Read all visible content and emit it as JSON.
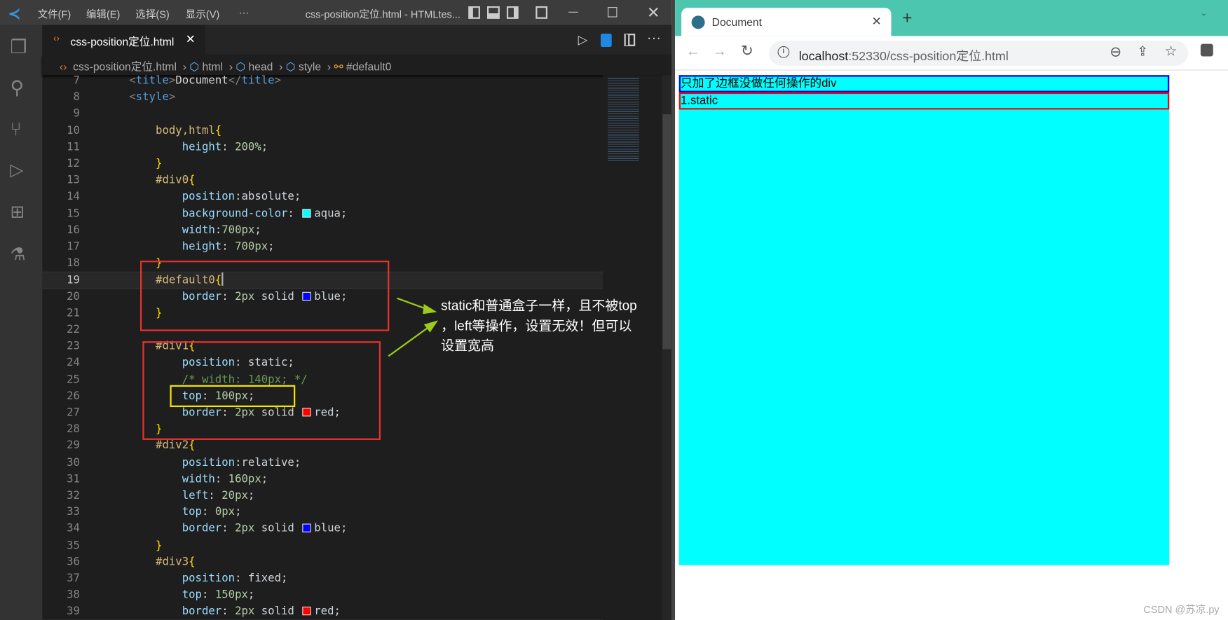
{
  "vscode": {
    "menu": [
      "文件(F)",
      "编辑(E)",
      "选择(S)",
      "显示(V)",
      "···"
    ],
    "window_title": "css-position定位.html - HTMLtes...",
    "tab_label": "css-position定位.html",
    "breadcrumb": [
      "css-position定位.html",
      "html",
      "head",
      "style",
      "#default0"
    ],
    "cursor_line": 19,
    "lines": [
      {
        "n": 7,
        "i": 2,
        "t": [
          [
            "br",
            "<"
          ],
          [
            "tag",
            "title"
          ],
          [
            "br",
            ">"
          ],
          [
            "txt",
            "Document"
          ],
          [
            "br",
            "</"
          ],
          [
            "tag",
            "title"
          ],
          [
            "br",
            ">"
          ]
        ]
      },
      {
        "n": 8,
        "i": 2,
        "t": [
          [
            "br",
            "<"
          ],
          [
            "tag",
            "style"
          ],
          [
            "br",
            ">"
          ]
        ]
      },
      {
        "n": 9,
        "i": 0,
        "t": []
      },
      {
        "n": 10,
        "i": 3,
        "t": [
          [
            "sel",
            "body,html"
          ],
          [
            "brace",
            "{"
          ]
        ]
      },
      {
        "n": 11,
        "i": 4,
        "t": [
          [
            "prop",
            "height"
          ],
          [
            "p",
            ": "
          ],
          [
            "num",
            "200%"
          ],
          [
            "p",
            ";"
          ]
        ]
      },
      {
        "n": 12,
        "i": 3,
        "t": [
          [
            "brace",
            "}"
          ]
        ]
      },
      {
        "n": 13,
        "i": 3,
        "t": [
          [
            "sel",
            "#div0"
          ],
          [
            "brace",
            "{"
          ]
        ]
      },
      {
        "n": 14,
        "i": 4,
        "t": [
          [
            "prop",
            "position"
          ],
          [
            "p",
            ":"
          ],
          [
            "val",
            "absolute"
          ],
          [
            "p",
            ";"
          ]
        ]
      },
      {
        "n": 15,
        "i": 4,
        "t": [
          [
            "prop",
            "background-color"
          ],
          [
            "p",
            ": "
          ],
          [
            "sw",
            "#00ffff"
          ],
          [
            "val",
            "aqua"
          ],
          [
            "p",
            ";"
          ]
        ]
      },
      {
        "n": 16,
        "i": 4,
        "t": [
          [
            "prop",
            "width"
          ],
          [
            "p",
            ":"
          ],
          [
            "num",
            "700px"
          ],
          [
            "p",
            ";"
          ]
        ]
      },
      {
        "n": 17,
        "i": 4,
        "t": [
          [
            "prop",
            "height"
          ],
          [
            "p",
            ": "
          ],
          [
            "num",
            "700px"
          ],
          [
            "p",
            ";"
          ]
        ]
      },
      {
        "n": 18,
        "i": 3,
        "t": [
          [
            "brace",
            "}"
          ]
        ]
      },
      {
        "n": 19,
        "i": 3,
        "t": [
          [
            "sel",
            "#default0"
          ],
          [
            "brace",
            "{"
          ]
        ]
      },
      {
        "n": 20,
        "i": 4,
        "t": [
          [
            "prop",
            "border"
          ],
          [
            "p",
            ": "
          ],
          [
            "num",
            "2px"
          ],
          [
            "val",
            " solid "
          ],
          [
            "sw",
            "#0000ff"
          ],
          [
            "val",
            "blue"
          ],
          [
            "p",
            ";"
          ]
        ]
      },
      {
        "n": 21,
        "i": 3,
        "t": [
          [
            "brace",
            "}"
          ]
        ]
      },
      {
        "n": 22,
        "i": 0,
        "t": []
      },
      {
        "n": 23,
        "i": 3,
        "t": [
          [
            "sel",
            "#div1"
          ],
          [
            "brace",
            "{"
          ]
        ]
      },
      {
        "n": 24,
        "i": 4,
        "t": [
          [
            "prop",
            "position"
          ],
          [
            "p",
            ": "
          ],
          [
            "val",
            "static"
          ],
          [
            "p",
            ";"
          ]
        ]
      },
      {
        "n": 25,
        "i": 4,
        "t": [
          [
            "com",
            "/* width: 140px; */"
          ]
        ]
      },
      {
        "n": 26,
        "i": 4,
        "t": [
          [
            "prop",
            "top"
          ],
          [
            "p",
            ": "
          ],
          [
            "num",
            "100px"
          ],
          [
            "p",
            ";"
          ]
        ]
      },
      {
        "n": 27,
        "i": 4,
        "t": [
          [
            "prop",
            "border"
          ],
          [
            "p",
            ": "
          ],
          [
            "num",
            "2px"
          ],
          [
            "val",
            " solid "
          ],
          [
            "sw",
            "#ff0000"
          ],
          [
            "val",
            "red"
          ],
          [
            "p",
            ";"
          ]
        ]
      },
      {
        "n": 28,
        "i": 3,
        "t": [
          [
            "brace",
            "}"
          ]
        ]
      },
      {
        "n": 29,
        "i": 3,
        "t": [
          [
            "sel",
            "#div2"
          ],
          [
            "brace",
            "{"
          ]
        ]
      },
      {
        "n": 30,
        "i": 4,
        "t": [
          [
            "prop",
            "position"
          ],
          [
            "p",
            ":"
          ],
          [
            "val",
            "relative"
          ],
          [
            "p",
            ";"
          ]
        ]
      },
      {
        "n": 31,
        "i": 4,
        "t": [
          [
            "prop",
            "width"
          ],
          [
            "p",
            ": "
          ],
          [
            "num",
            "160px"
          ],
          [
            "p",
            ";"
          ]
        ]
      },
      {
        "n": 32,
        "i": 4,
        "t": [
          [
            "prop",
            "left"
          ],
          [
            "p",
            ": "
          ],
          [
            "num",
            "20px"
          ],
          [
            "p",
            ";"
          ]
        ]
      },
      {
        "n": 33,
        "i": 4,
        "t": [
          [
            "prop",
            "top"
          ],
          [
            "p",
            ": "
          ],
          [
            "num",
            "0px"
          ],
          [
            "p",
            ";"
          ]
        ]
      },
      {
        "n": 34,
        "i": 4,
        "t": [
          [
            "prop",
            "border"
          ],
          [
            "p",
            ": "
          ],
          [
            "num",
            "2px"
          ],
          [
            "val",
            " solid "
          ],
          [
            "sw",
            "#0000ff"
          ],
          [
            "val",
            "blue"
          ],
          [
            "p",
            ";"
          ]
        ]
      },
      {
        "n": 35,
        "i": 3,
        "t": [
          [
            "brace",
            "}"
          ]
        ]
      },
      {
        "n": 36,
        "i": 3,
        "t": [
          [
            "sel",
            "#div3"
          ],
          [
            "brace",
            "{"
          ]
        ]
      },
      {
        "n": 37,
        "i": 4,
        "t": [
          [
            "prop",
            "position"
          ],
          [
            "p",
            ": "
          ],
          [
            "val",
            "fixed"
          ],
          [
            "p",
            ";"
          ]
        ]
      },
      {
        "n": 38,
        "i": 4,
        "t": [
          [
            "prop",
            "top"
          ],
          [
            "p",
            ": "
          ],
          [
            "num",
            "150px"
          ],
          [
            "p",
            ";"
          ]
        ]
      },
      {
        "n": 39,
        "i": 4,
        "t": [
          [
            "prop",
            "border"
          ],
          [
            "p",
            ": "
          ],
          [
            "num",
            "2px"
          ],
          [
            "val",
            " solid "
          ],
          [
            "sw",
            "#ff0000"
          ],
          [
            "val",
            "red"
          ],
          [
            "p",
            ";"
          ]
        ]
      }
    ]
  },
  "annotation": {
    "lines": [
      "static和普通盒子一样，且不被top",
      "，left等操作，设置无效！但可以",
      "设置宽高"
    ]
  },
  "browser": {
    "tab_title": "Document",
    "url_host": "localhost",
    "url_rest": ":52330/css-position定位.html",
    "div_default_text": "只加了边框没做任何操作的div",
    "div1_text": "1.static"
  },
  "watermark": "CSDN @苏凉.py",
  "colors": {
    "aqua": "#00ffff",
    "blue": "#0000ff",
    "red": "#ff0000",
    "browser_frame": "#4cc6ae"
  }
}
